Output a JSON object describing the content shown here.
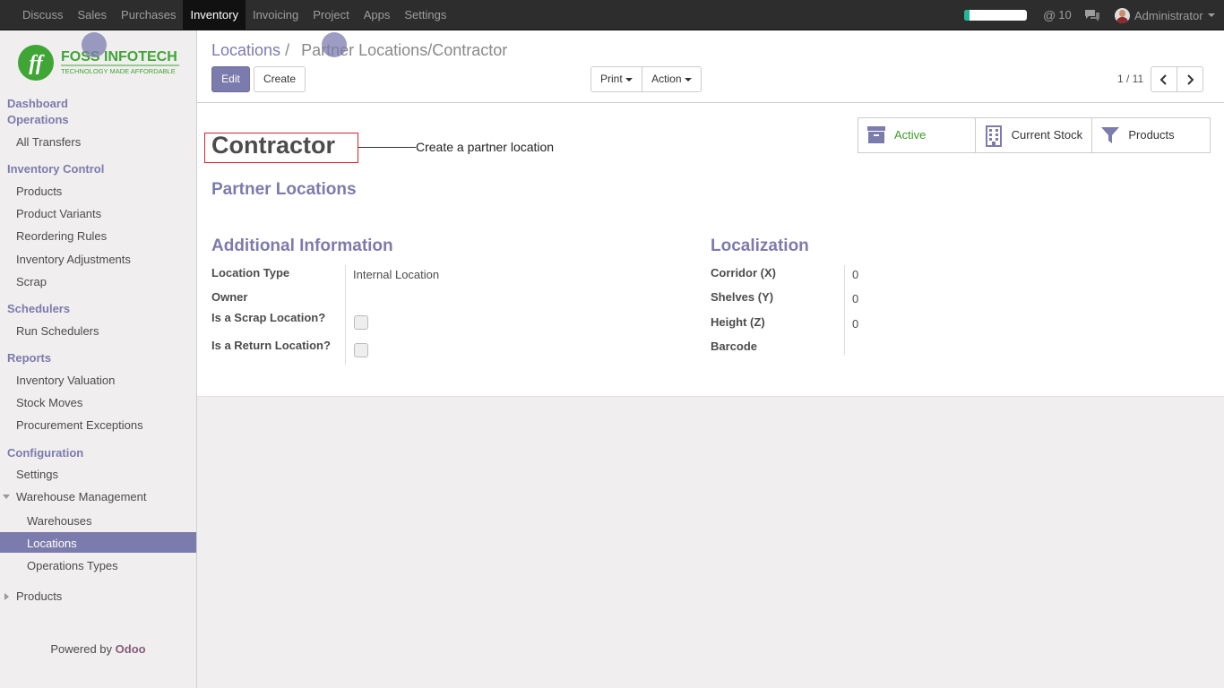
{
  "topbar": {
    "menu": [
      "Discuss",
      "Sales",
      "Purchases",
      "Inventory",
      "Invoicing",
      "Project",
      "Apps",
      "Settings"
    ],
    "active_menu": "Inventory",
    "progress_fraction": 0.08,
    "mentions_count": "10",
    "user_name": "Administrator"
  },
  "sidebar": {
    "logo_text": "FOSS INFOTECH",
    "logo_tagline": "TECHNOLOGY MADE AFFORDABLE",
    "sections": {
      "dashboard": "Dashboard",
      "operations": "Operations",
      "inventory_control": "Inventory Control",
      "schedulers": "Schedulers",
      "reports": "Reports",
      "configuration": "Configuration"
    },
    "links": {
      "all_transfers": "All Transfers",
      "products": "Products",
      "product_variants": "Product Variants",
      "reordering_rules": "Reordering Rules",
      "inventory_adjustments": "Inventory Adjustments",
      "scrap": "Scrap",
      "run_schedulers": "Run Schedulers",
      "inventory_valuation": "Inventory Valuation",
      "stock_moves": "Stock Moves",
      "procurement_exceptions": "Procurement Exceptions",
      "settings": "Settings",
      "warehouse_management": "Warehouse Management",
      "warehouses": "Warehouses",
      "locations": "Locations",
      "operations_types": "Operations Types",
      "products_group": "Products"
    },
    "powered_by": "Powered by",
    "powered_brand": "Odoo"
  },
  "control_panel": {
    "breadcrumb_root": "Locations",
    "breadcrumb_sep": "/",
    "breadcrumb_current": "Partner Locations/Contractor",
    "edit_label": "Edit",
    "create_label": "Create",
    "print_label": "Print",
    "action_label": "Action",
    "pager": "1 / 11"
  },
  "form": {
    "title": "Contractor",
    "annotation": "Create a partner location",
    "parent_location": "Partner Locations",
    "stat_buttons": {
      "active": "Active",
      "current_stock": "Current Stock",
      "products": "Products"
    },
    "additional_info_title": "Additional Information",
    "localization_title": "Localization",
    "fields": {
      "location_type_label": "Location Type",
      "location_type_value": "Internal Location",
      "owner_label": "Owner",
      "is_scrap_label": "Is a Scrap Location?",
      "is_return_label": "Is a Return Location?",
      "corridor_label": "Corridor (X)",
      "corridor_value": "0",
      "shelves_label": "Shelves (Y)",
      "shelves_value": "0",
      "height_label": "Height (Z)",
      "height_value": "0",
      "barcode_label": "Barcode"
    }
  },
  "colors": {
    "accent": "#7c7bad",
    "topbar": "#2d2d2d",
    "active_green": "#3d9a28",
    "highlight_red": "#d9222a"
  }
}
